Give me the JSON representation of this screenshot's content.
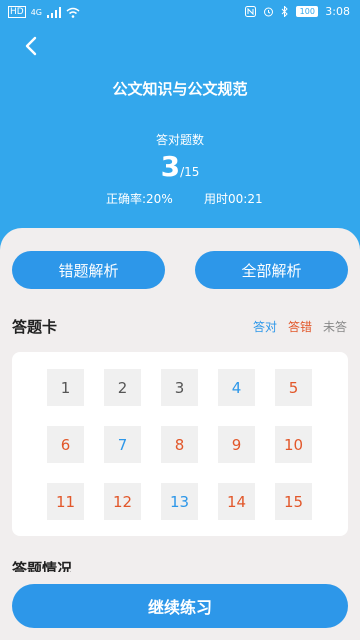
{
  "status_bar": {
    "left_text": "HD",
    "signal_text": "4G",
    "battery": "100",
    "time": "3:08"
  },
  "header": {
    "title": "公文知识与公文规范",
    "score_label": "答对题数",
    "correct": "3",
    "total": "/15",
    "accuracy": "正确率:20%",
    "time_used": "用时00:21"
  },
  "buttons": {
    "wrong_analysis": "错题解析",
    "all_analysis": "全部解析",
    "continue": "继续练习"
  },
  "answer_card": {
    "title": "答题卡",
    "legend": {
      "correct": "答对",
      "wrong": "答错",
      "unanswered": "未答"
    },
    "questions": [
      {
        "n": "1",
        "state": "unanswered"
      },
      {
        "n": "2",
        "state": "unanswered"
      },
      {
        "n": "3",
        "state": "unanswered"
      },
      {
        "n": "4",
        "state": "correct"
      },
      {
        "n": "5",
        "state": "wrong"
      },
      {
        "n": "6",
        "state": "wrong"
      },
      {
        "n": "7",
        "state": "correct"
      },
      {
        "n": "8",
        "state": "wrong"
      },
      {
        "n": "9",
        "state": "wrong"
      },
      {
        "n": "10",
        "state": "wrong"
      },
      {
        "n": "11",
        "state": "wrong"
      },
      {
        "n": "12",
        "state": "wrong"
      },
      {
        "n": "13",
        "state": "correct"
      },
      {
        "n": "14",
        "state": "wrong"
      },
      {
        "n": "15",
        "state": "wrong"
      }
    ]
  },
  "section2": {
    "title": "答题情况"
  },
  "colors": {
    "primary": "#2d97e9",
    "header_bg": "#33a7ec",
    "correct": "#2d97e9",
    "wrong": "#e2572a",
    "unanswered": "#555555"
  }
}
